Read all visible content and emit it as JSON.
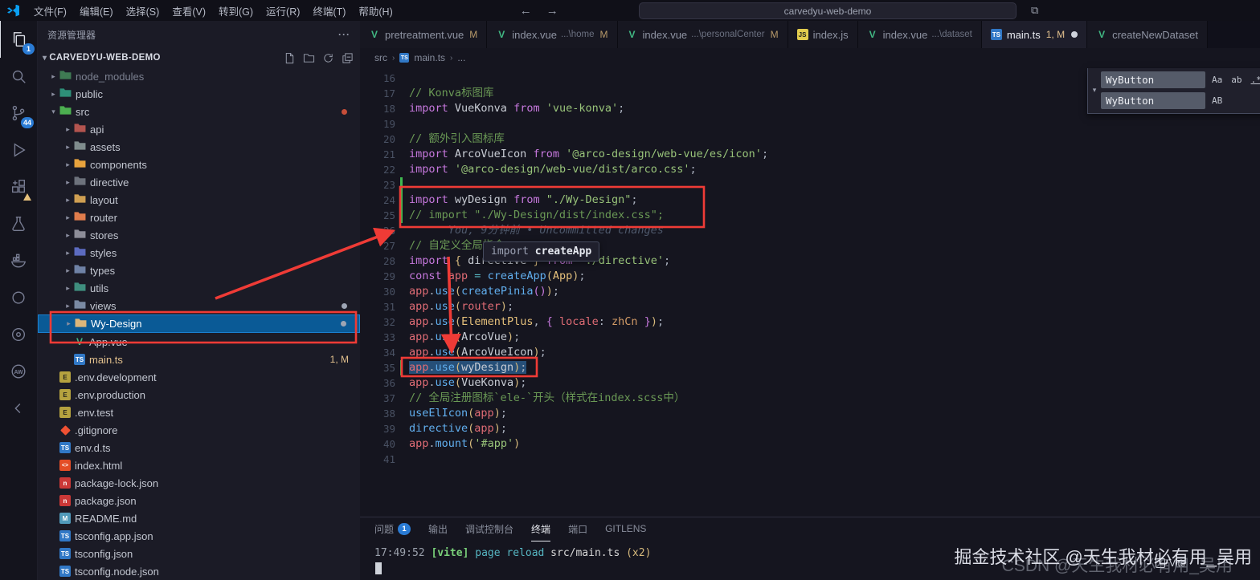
{
  "titlebar": {
    "menus": [
      "文件(F)",
      "编辑(E)",
      "选择(S)",
      "查看(V)",
      "转到(G)",
      "运行(R)",
      "终端(T)",
      "帮助(H)"
    ],
    "back_arrow": "←",
    "forward_arrow": "→",
    "search_box": "carvedyu-web-demo"
  },
  "activity": {
    "items": [
      {
        "name": "explorer",
        "badge": "1",
        "active": true
      },
      {
        "name": "search"
      },
      {
        "name": "source-control",
        "badge": "44"
      },
      {
        "name": "run-debug"
      },
      {
        "name": "extensions",
        "warn": true
      },
      {
        "name": "testing"
      },
      {
        "name": "docker"
      },
      {
        "name": "live-share"
      },
      {
        "name": "gitlens"
      },
      {
        "name": "aw-extension"
      },
      {
        "name": "back"
      }
    ]
  },
  "explorer": {
    "title": "资源管理器",
    "more": "···",
    "project": "CARVEDYU-WEB-DEMO",
    "items": [
      {
        "label": "node_modules",
        "kind": "folder",
        "depth": 1,
        "color": "#3f7a53",
        "dim": true
      },
      {
        "label": "public",
        "kind": "folder",
        "depth": 1,
        "color": "#2e8f78"
      },
      {
        "label": "src",
        "kind": "folder",
        "depth": 1,
        "color": "#4caf50",
        "open": true,
        "dot": "#c74e39"
      },
      {
        "label": "api",
        "kind": "folder",
        "depth": 2,
        "color": "#b3544f"
      },
      {
        "label": "assets",
        "kind": "folder",
        "depth": 2,
        "color": "#7f8c8d"
      },
      {
        "label": "components",
        "kind": "folder",
        "depth": 2,
        "color": "#e8a33d"
      },
      {
        "label": "directive",
        "kind": "folder",
        "depth": 2,
        "color": "#6d727c"
      },
      {
        "label": "layout",
        "kind": "folder",
        "depth": 2,
        "color": "#cf9f52"
      },
      {
        "label": "router",
        "kind": "folder",
        "depth": 2,
        "color": "#e07c4c"
      },
      {
        "label": "stores",
        "kind": "folder",
        "depth": 2,
        "color": "#8d8d98"
      },
      {
        "label": "styles",
        "kind": "folder",
        "depth": 2,
        "color": "#5c6bc0"
      },
      {
        "label": "types",
        "kind": "folder",
        "depth": 2,
        "color": "#6f82a6"
      },
      {
        "label": "utils",
        "kind": "folder",
        "depth": 2,
        "color": "#3f8e7e"
      },
      {
        "label": "views",
        "kind": "folder",
        "depth": 2,
        "color": "#7a8aa3",
        "dot": "#9da5b4"
      },
      {
        "label": "Wy-Design",
        "kind": "folder",
        "depth": 2,
        "color": "#dcb67a",
        "selected": true,
        "dot": "#9da5b4"
      },
      {
        "label": "App.vue",
        "kind": "vue",
        "depth": 2
      },
      {
        "label": "main.ts",
        "kind": "ts",
        "depth": 2,
        "badge": "1, M",
        "modified": true
      },
      {
        "label": ".env.development",
        "kind": "env",
        "depth": 1
      },
      {
        "label": ".env.production",
        "kind": "env",
        "depth": 1
      },
      {
        "label": ".env.test",
        "kind": "env",
        "depth": 1
      },
      {
        "label": ".gitignore",
        "kind": "git",
        "depth": 1
      },
      {
        "label": "env.d.ts",
        "kind": "ts",
        "depth": 1
      },
      {
        "label": "index.html",
        "kind": "html",
        "depth": 1
      },
      {
        "label": "package-lock.json",
        "kind": "npm",
        "depth": 1
      },
      {
        "label": "package.json",
        "kind": "npm",
        "depth": 1
      },
      {
        "label": "README.md",
        "kind": "md",
        "depth": 1
      },
      {
        "label": "tsconfig.app.json",
        "kind": "ts",
        "depth": 1
      },
      {
        "label": "tsconfig.json",
        "kind": "ts",
        "depth": 1
      },
      {
        "label": "tsconfig.node.json",
        "kind": "ts",
        "depth": 1
      }
    ]
  },
  "tabs": [
    {
      "icon": "vue",
      "label": "pretreatment.vue",
      "git": "M"
    },
    {
      "icon": "vue",
      "label": "index.vue",
      "desc": "...\\home",
      "git": "M"
    },
    {
      "icon": "vue",
      "label": "index.vue",
      "desc": "...\\personalCenter",
      "git": "M"
    },
    {
      "icon": "js",
      "label": "index.js"
    },
    {
      "icon": "vue",
      "label": "index.vue",
      "desc": "...\\dataset"
    },
    {
      "icon": "ts",
      "label": "main.ts",
      "git": "1, M",
      "active": true,
      "dirty": true
    },
    {
      "icon": "vue",
      "label": "createNewDataset"
    }
  ],
  "breadcrumb": {
    "parts": [
      {
        "label": "src"
      },
      {
        "label": "main.ts",
        "icon": "ts"
      },
      {
        "label": "..."
      }
    ]
  },
  "code": {
    "lines": [
      {
        "n": 16,
        "t": []
      },
      {
        "n": 17,
        "t": [
          [
            "// Konva标图库",
            "cmt"
          ]
        ]
      },
      {
        "n": 18,
        "t": [
          [
            "import ",
            "kw"
          ],
          [
            "VueKonva",
            "txt"
          ],
          [
            " from ",
            "kw"
          ],
          [
            "'vue-konva'",
            "str"
          ],
          [
            ";",
            "pun"
          ]
        ]
      },
      {
        "n": 19,
        "t": []
      },
      {
        "n": 20,
        "t": [
          [
            "// 额外引入图标库",
            "cmt"
          ]
        ]
      },
      {
        "n": 21,
        "t": [
          [
            "import ",
            "kw"
          ],
          [
            "ArcoVueIcon",
            "txt"
          ],
          [
            " from ",
            "kw"
          ],
          [
            "'@arco-design/web-vue/es/icon'",
            "str"
          ],
          [
            ";",
            "pun"
          ]
        ]
      },
      {
        "n": 22,
        "t": [
          [
            "import ",
            "kw"
          ],
          [
            "'@arco-design/web-vue/dist/arco.css'",
            "str"
          ],
          [
            ";",
            "pun"
          ]
        ]
      },
      {
        "n": 23,
        "t": [],
        "git": true
      },
      {
        "n": 24,
        "t": [
          [
            "import ",
            "kw"
          ],
          [
            "wyDesign",
            "txt"
          ],
          [
            " from ",
            "kw"
          ],
          [
            "\"./Wy-Design\"",
            "str"
          ],
          [
            ";",
            "pun"
          ]
        ],
        "git": true
      },
      {
        "n": 25,
        "t": [
          [
            "// import \"./Wy-Design/dist/index.css\";",
            "cmt"
          ]
        ],
        "git": true
      },
      {
        "n": 26,
        "t": [
          [
            "      You, 9分钟前 • Uncommitted changes",
            "blame"
          ]
        ]
      },
      {
        "n": 27,
        "t": [
          [
            "// 自定义全局指令",
            "cmt"
          ]
        ]
      },
      {
        "n": 28,
        "t": [
          [
            "import ",
            "kw"
          ],
          [
            "{ ",
            "gold"
          ],
          [
            "directive",
            "txt"
          ],
          [
            " }",
            "gold"
          ],
          [
            " from ",
            "kw"
          ],
          [
            "'./directive'",
            "str"
          ],
          [
            ";",
            "pun"
          ]
        ]
      },
      {
        "n": 29,
        "t": [
          [
            "const ",
            "kw"
          ],
          [
            "app",
            "var"
          ],
          [
            " = ",
            "op"
          ],
          [
            "createApp",
            "fn"
          ],
          [
            "(",
            "gold"
          ],
          [
            "App",
            "cls"
          ],
          [
            ")",
            "gold"
          ],
          [
            ";",
            "pun"
          ]
        ]
      },
      {
        "n": 30,
        "t": [
          [
            "app",
            "var"
          ],
          [
            ".",
            "pun"
          ],
          [
            "use",
            "fn"
          ],
          [
            "(",
            "gold"
          ],
          [
            "createPinia",
            "fn"
          ],
          [
            "()",
            "gold2"
          ],
          [
            ")",
            "gold"
          ],
          [
            ";",
            "pun"
          ]
        ]
      },
      {
        "n": 31,
        "t": [
          [
            "app",
            "var"
          ],
          [
            ".",
            "pun"
          ],
          [
            "use",
            "fn"
          ],
          [
            "(",
            "gold"
          ],
          [
            "router",
            "var"
          ],
          [
            ")",
            "gold"
          ],
          [
            ";",
            "pun"
          ]
        ]
      },
      {
        "n": 32,
        "t": [
          [
            "app",
            "var"
          ],
          [
            ".",
            "pun"
          ],
          [
            "use",
            "fn"
          ],
          [
            "(",
            "gold"
          ],
          [
            "ElementPlus",
            "cls"
          ],
          [
            ", ",
            "pun"
          ],
          [
            "{ ",
            "gold2"
          ],
          [
            "locale",
            "var"
          ],
          [
            ": ",
            "pun"
          ],
          [
            "zhCn",
            "orange"
          ],
          [
            " }",
            "gold2"
          ],
          [
            ")",
            "gold"
          ],
          [
            ";",
            "pun"
          ]
        ]
      },
      {
        "n": 33,
        "t": [
          [
            "app",
            "var"
          ],
          [
            ".",
            "pun"
          ],
          [
            "use",
            "fn"
          ],
          [
            "(",
            "gold"
          ],
          [
            "ArcoVue",
            "txt"
          ],
          [
            ")",
            "gold"
          ],
          [
            ";",
            "pun"
          ]
        ]
      },
      {
        "n": 34,
        "t": [
          [
            "app",
            "var"
          ],
          [
            ".",
            "pun"
          ],
          [
            "use",
            "fn"
          ],
          [
            "(",
            "gold"
          ],
          [
            "ArcoVueIcon",
            "txt"
          ],
          [
            ")",
            "gold"
          ],
          [
            ";",
            "pun"
          ]
        ]
      },
      {
        "n": 35,
        "t": [
          [
            "app",
            "var"
          ],
          [
            ".",
            "pun"
          ],
          [
            "use",
            "fn"
          ],
          [
            "(",
            "gold"
          ],
          [
            "wyDesign",
            "txt"
          ],
          [
            ")",
            "gold"
          ],
          [
            ";",
            "pun"
          ]
        ],
        "git": true,
        "sel": true
      },
      {
        "n": 36,
        "t": [
          [
            "app",
            "var"
          ],
          [
            ".",
            "pun"
          ],
          [
            "use",
            "fn"
          ],
          [
            "(",
            "gold"
          ],
          [
            "VueKonva",
            "txt"
          ],
          [
            ")",
            "gold"
          ],
          [
            ";",
            "pun"
          ]
        ]
      },
      {
        "n": 37,
        "t": [
          [
            "// 全局注册图标`ele-`开头（样式在index.scss中）",
            "cmt"
          ]
        ]
      },
      {
        "n": 38,
        "t": [
          [
            "useElIcon",
            "fn"
          ],
          [
            "(",
            "gold"
          ],
          [
            "app",
            "var"
          ],
          [
            ")",
            "gold"
          ],
          [
            ";",
            "pun"
          ]
        ]
      },
      {
        "n": 39,
        "t": [
          [
            "directive",
            "fn"
          ],
          [
            "(",
            "gold"
          ],
          [
            "app",
            "var"
          ],
          [
            ")",
            "gold"
          ],
          [
            ";",
            "pun"
          ]
        ]
      },
      {
        "n": 40,
        "t": [
          [
            "app",
            "var"
          ],
          [
            ".",
            "pun"
          ],
          [
            "mount",
            "fn"
          ],
          [
            "(",
            "gold"
          ],
          [
            "'#app'",
            "str"
          ],
          [
            ")",
            "gold"
          ]
        ]
      },
      {
        "n": 41,
        "t": []
      }
    ]
  },
  "tooltip": {
    "keyword": "import ",
    "name": "createApp"
  },
  "find": {
    "query": "WyButton",
    "replace": "WyButton",
    "find_options": [
      "Aa",
      "ab",
      ".*"
    ],
    "replace_options": [
      "AB"
    ],
    "chevron": "▾"
  },
  "panel": {
    "tabs": [
      {
        "label": "问题",
        "badge": "1"
      },
      {
        "label": "输出"
      },
      {
        "label": "调试控制台"
      },
      {
        "label": "终端",
        "active": true
      },
      {
        "label": "端口"
      },
      {
        "label": "GITLENS"
      }
    ],
    "terminal_line": [
      [
        "17:49:52 ",
        "tgray"
      ],
      [
        "[vite] ",
        "tgreen"
      ],
      [
        "page reload ",
        "tcyan"
      ],
      [
        "src/main.ts ",
        "twhite"
      ],
      [
        "(x2)",
        "tyellow"
      ]
    ],
    "process": "Vite"
  },
  "watermarks": {
    "primary": "掘金技术社区 @天生我材必有用_吴用",
    "secondary": "CSDN @天生我材必有用_吴用"
  },
  "annotation_color": "#ef3b36"
}
